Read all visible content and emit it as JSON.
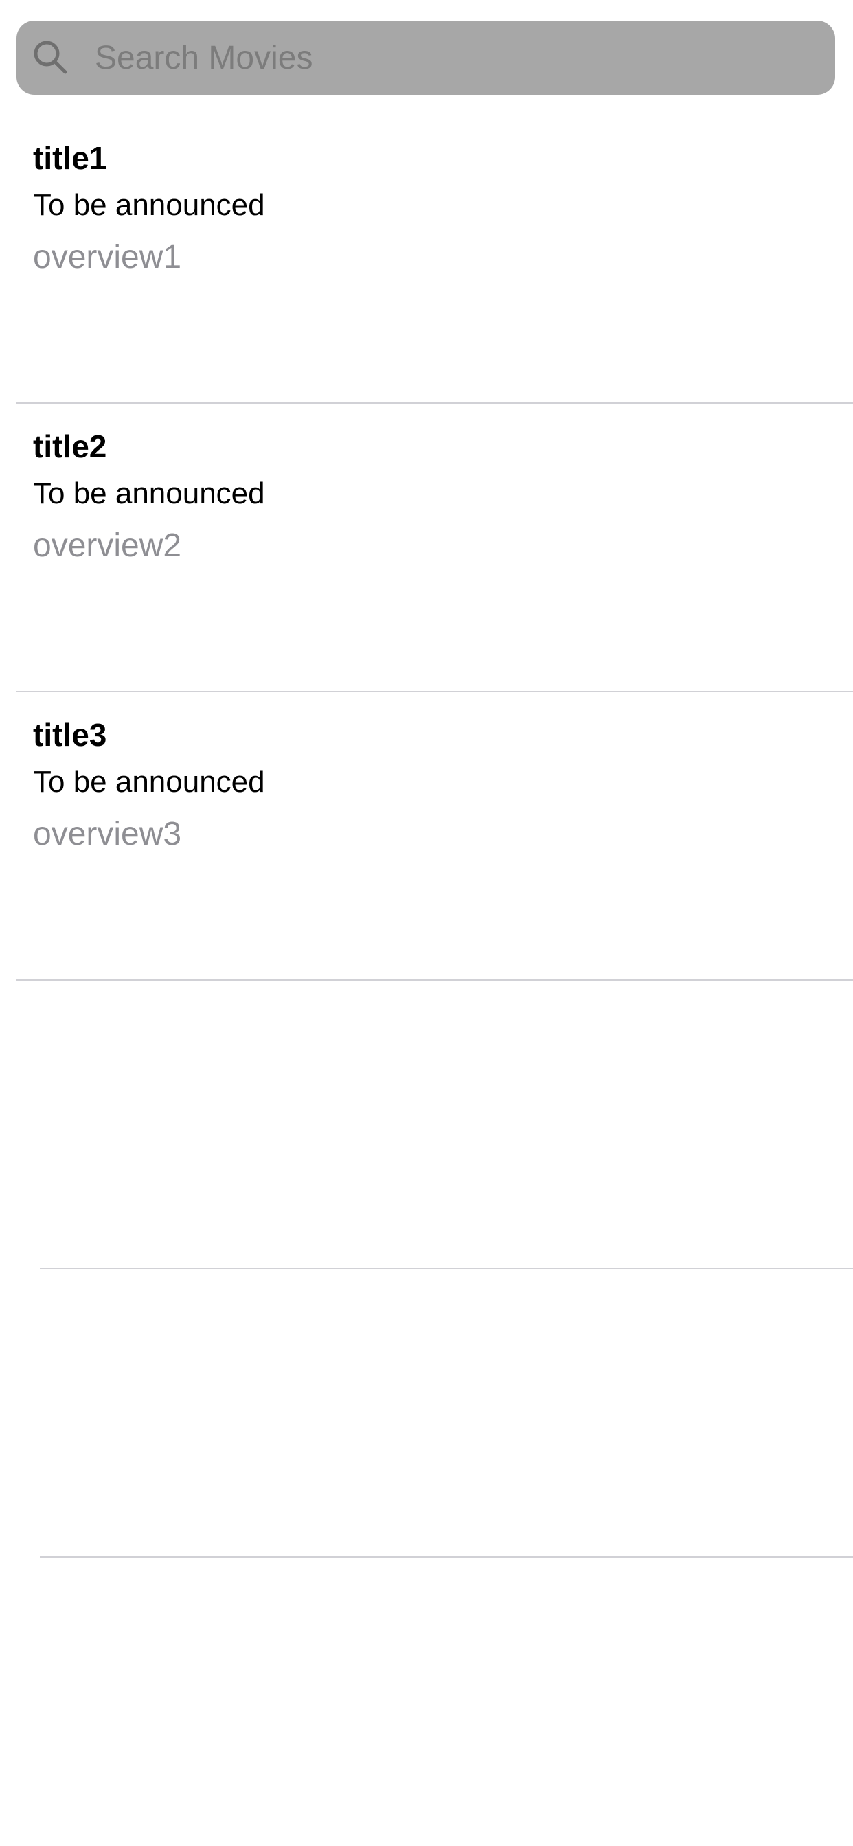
{
  "search": {
    "placeholder": "Search Movies",
    "value": ""
  },
  "movies": [
    {
      "title": "title1",
      "release": "To be announced",
      "overview": "overview1"
    },
    {
      "title": "title2",
      "release": "To be announced",
      "overview": "overview2"
    },
    {
      "title": "title3",
      "release": "To be announced",
      "overview": "overview3"
    }
  ],
  "colors": {
    "search_bar_bg": "#a7a7a7",
    "placeholder": "#7c7c7c",
    "overview_text": "#8e8e93",
    "separator": "#d1d1d6"
  }
}
